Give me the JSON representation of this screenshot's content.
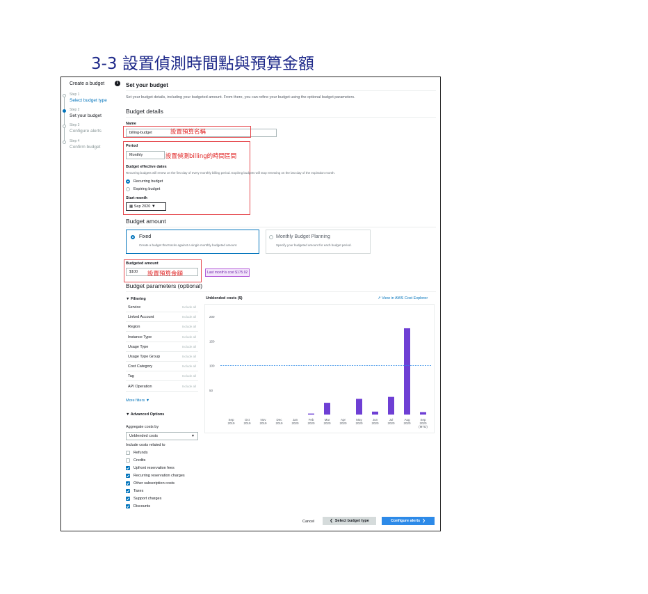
{
  "slide": {
    "title": "3-3 設置偵測時間點與預算金額"
  },
  "sidebar": {
    "header": "Create a budget",
    "info_icon": "info-icon",
    "steps": [
      {
        "num": "Step 1",
        "label": "Select budget type",
        "state": "link"
      },
      {
        "num": "Step 2",
        "label": "Set your budget",
        "state": "active"
      },
      {
        "num": "Step 3",
        "label": "Configure alerts",
        "state": "muted"
      },
      {
        "num": "Step 4",
        "label": "Confirm budget",
        "state": "muted"
      }
    ]
  },
  "main": {
    "title": "Set your budget",
    "description": "Set your budget details, including your budgeted amount. From there, you can refine your budget using the optional budget parameters.",
    "details_title": "Budget details",
    "name_label": "Name",
    "name_value": "billing-budget",
    "period_label": "Period",
    "period_value": "Monthly",
    "effective_label": "Budget effective dates",
    "effective_hint": "Recurring budgets will renew on the first day of every monthly billing period. Expiring budgets will stop renewing on the last day of the expiration month.",
    "recurring_label": "Recurring budget",
    "expiring_label": "Expiring budget",
    "start_month_label": "Start month",
    "start_month_value": "Sep 2020",
    "amount_title": "Budget amount",
    "fixed_label": "Fixed",
    "fixed_desc": "Create a budget that tracks against a single monthly budgeted amount.",
    "planning_label": "Monthly Budget Planning",
    "planning_desc": "Specify your budgeted amount for each budget period.",
    "budgeted_amount_label": "Budgeted amount",
    "budgeted_amount_value": "$100",
    "last_month_chip": "Last month's cost $175.92",
    "params_title": "Budget parameters (optional)"
  },
  "annotations": {
    "name": "設置預算名稱",
    "period": "設置偵測billing的時間區間",
    "amount": "設置預算金額"
  },
  "filtering": {
    "title": "Filtering",
    "include_all": "Include all",
    "rows": [
      "Service",
      "Linked Account",
      "Region",
      "Instance Type",
      "Usage Type",
      "Usage Type Group",
      "Cost Category",
      "Tag",
      "API Operation"
    ],
    "more": "More filters"
  },
  "advanced": {
    "title": "Advanced Options",
    "aggregate_label": "Aggregate costs by",
    "aggregate_value": "Unblended costs",
    "include_label": "Include costs related to",
    "items": [
      {
        "label": "Refunds",
        "checked": false
      },
      {
        "label": "Credits",
        "checked": false
      },
      {
        "label": "Upfront reservation fees",
        "checked": true
      },
      {
        "label": "Recurring reservation charges",
        "checked": true
      },
      {
        "label": "Other subscription costs",
        "checked": true
      },
      {
        "label": "Taxes",
        "checked": true
      },
      {
        "label": "Support charges",
        "checked": true
      },
      {
        "label": "Discounts",
        "checked": true
      }
    ]
  },
  "footer": {
    "cancel": "Cancel",
    "back": "Select budget type",
    "next": "Configure alerts"
  },
  "chart_link": "View in AWS Cost Explorer",
  "colors": {
    "accent": "#0073bb",
    "bar": "#6e3fd4",
    "annotation": "#e02424",
    "budget_line": "#2d8ae8"
  },
  "chart_data": {
    "type": "bar",
    "title": "Unblended costs ($)",
    "categories": [
      "Sep\n2019",
      "Oct\n2019",
      "Nov\n2019",
      "Dec\n2019",
      "Jan\n2020",
      "Feb\n2020",
      "Mar\n2020",
      "Apr\n2020",
      "May\n2020",
      "Jun\n2020",
      "Jul\n2020",
      "Aug\n2020",
      "Sep\n2020\n(MTD)"
    ],
    "values": [
      0,
      0,
      0,
      0,
      0,
      2,
      24,
      0,
      32,
      6,
      36,
      176,
      5
    ],
    "budget_line": 100,
    "yticks": [
      50,
      100,
      150,
      200
    ],
    "ylim": [
      0,
      210
    ],
    "grid": false
  }
}
